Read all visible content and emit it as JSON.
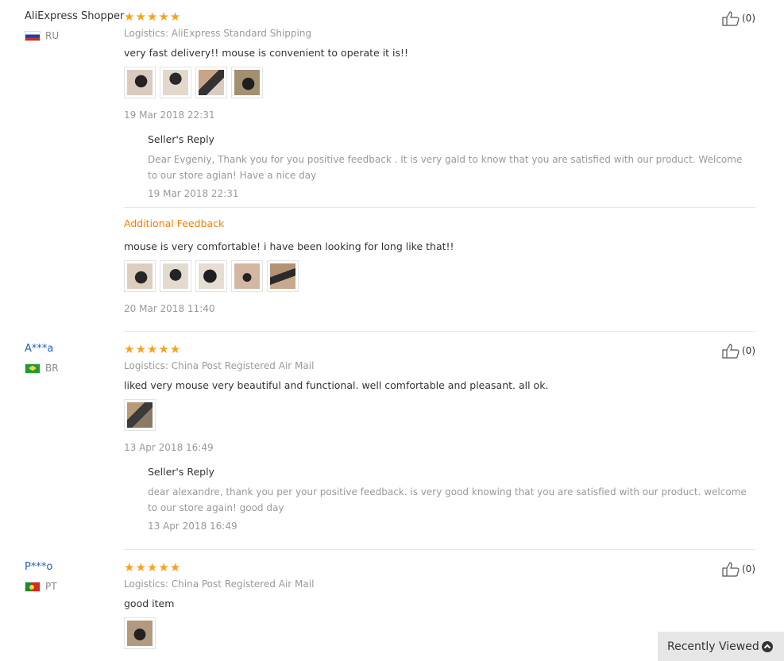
{
  "reviews": [
    {
      "user": "AliExpress Shopper",
      "country": "RU",
      "stars": "★★★★★",
      "logistics": "Logistics: AliExpress Standard Shipping",
      "text": "very fast delivery!! mouse is convenient to operate it is!!",
      "date": "19 Mar 2018 22:31",
      "helpful": "(0)",
      "reply": {
        "title": "Seller's Reply",
        "text": "Dear Evgeniy, Thank you for you positive feedback . It is very gald to know that you are satisfied with our product. Welcome to our store agian! Have a nice day",
        "date": "19 Mar 2018 22:31"
      },
      "additional": {
        "label": "Additional Feedback",
        "text": "mouse is very comfortable! i have been looking for long like that!!",
        "date": "20 Mar 2018 11:40"
      }
    },
    {
      "user": "A***a",
      "country": "BR",
      "stars": "★★★★★",
      "logistics": "Logistics: China Post Registered Air Mail",
      "text": "liked very mouse very beautiful and functional. well comfortable and pleasant. all ok.",
      "date": "13 Apr 2018 16:49",
      "helpful": "(0)",
      "reply": {
        "title": "Seller's Reply",
        "text": "dear alexandre, thank you per your positive feedback. is very good knowing that you are satisfied with our product. welcome to our store again! good day",
        "date": "13 Apr 2018 16:49"
      }
    },
    {
      "user": "P***o",
      "country": "PT",
      "stars": "★★★★★",
      "logistics": "Logistics: China Post Registered Air Mail",
      "text": "good item",
      "helpful": "(0)"
    }
  ],
  "recently_viewed": "Recently Viewed",
  "colors": {
    "star": "#f7a21d",
    "additional": "#f08200",
    "link": "#2a5db0"
  },
  "icons": {
    "helpful": "thumbs-up-icon",
    "recently": "chevron-up-circle-icon"
  }
}
